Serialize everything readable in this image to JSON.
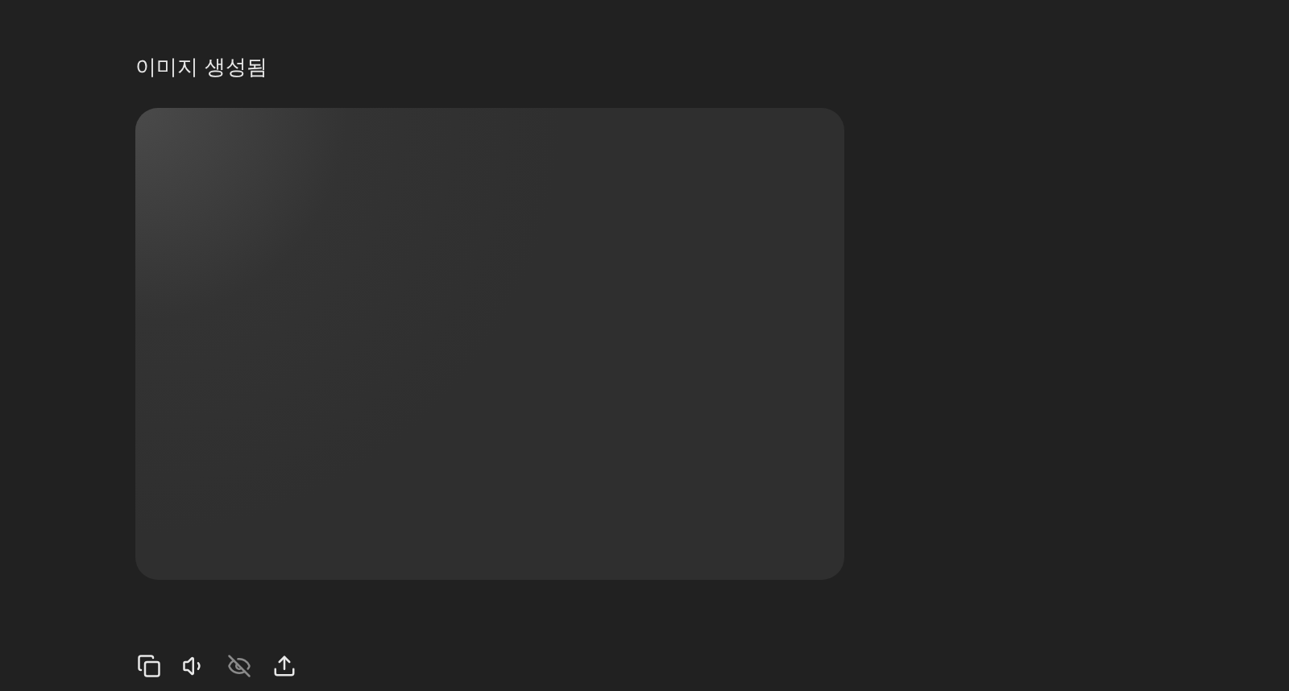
{
  "title": "이미지 생성됨",
  "actions": [
    {
      "kind": "copy",
      "disabled": false
    },
    {
      "kind": "speaker",
      "disabled": false
    },
    {
      "kind": "hide",
      "disabled": true
    },
    {
      "kind": "share",
      "disabled": false
    }
  ]
}
